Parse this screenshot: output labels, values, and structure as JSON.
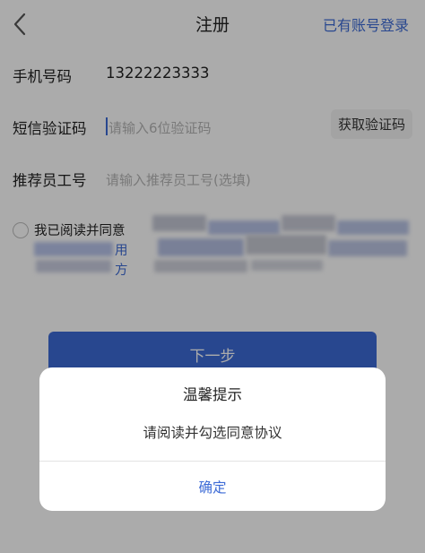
{
  "header": {
    "title": "注册",
    "login_link": "已有账号登录",
    "back_icon": "chevron-left-icon"
  },
  "form": {
    "phone": {
      "label": "手机号码",
      "value": "13222223333"
    },
    "sms_code": {
      "label": "短信验证码",
      "placeholder": "请输入6位验证码",
      "button_label": "获取验证码"
    },
    "referrer": {
      "label": "推荐员工号",
      "placeholder": "请输入推荐员工号(选填)"
    }
  },
  "agreement": {
    "text": "我已阅读并同意",
    "fragment_1": "用",
    "fragment_2": "方",
    "checked": false
  },
  "next_button": {
    "label": "下一步"
  },
  "dialog": {
    "title": "温馨提示",
    "message": "请阅读并勾选同意协议",
    "confirm_label": "确定"
  },
  "colors": {
    "accent": "#3d6bd6",
    "overlay": "rgba(0,0,0,0.33)"
  }
}
